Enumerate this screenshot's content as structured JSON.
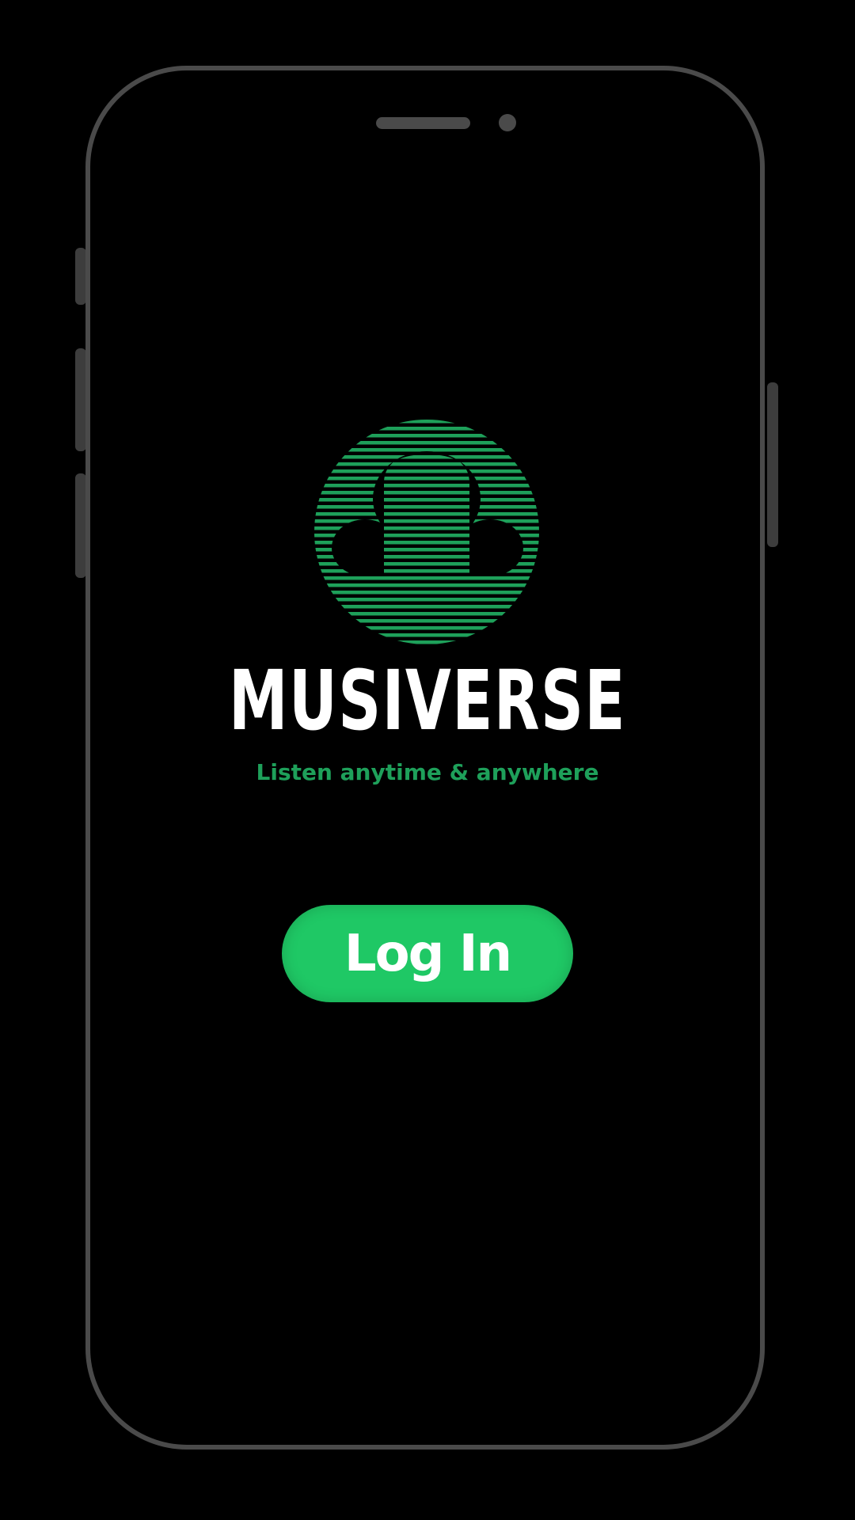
{
  "app": {
    "name": "MUSIVERSE",
    "tagline": "Listen anytime & anywhere"
  },
  "actions": {
    "login_label": "Log In"
  },
  "icons": {
    "logo": "headphones-cloud-icon"
  },
  "colors": {
    "background": "#000000",
    "accent": "#1fc865",
    "tagline": "#1ea05a",
    "frame": "#4a4a4a",
    "title": "#ffffff"
  }
}
